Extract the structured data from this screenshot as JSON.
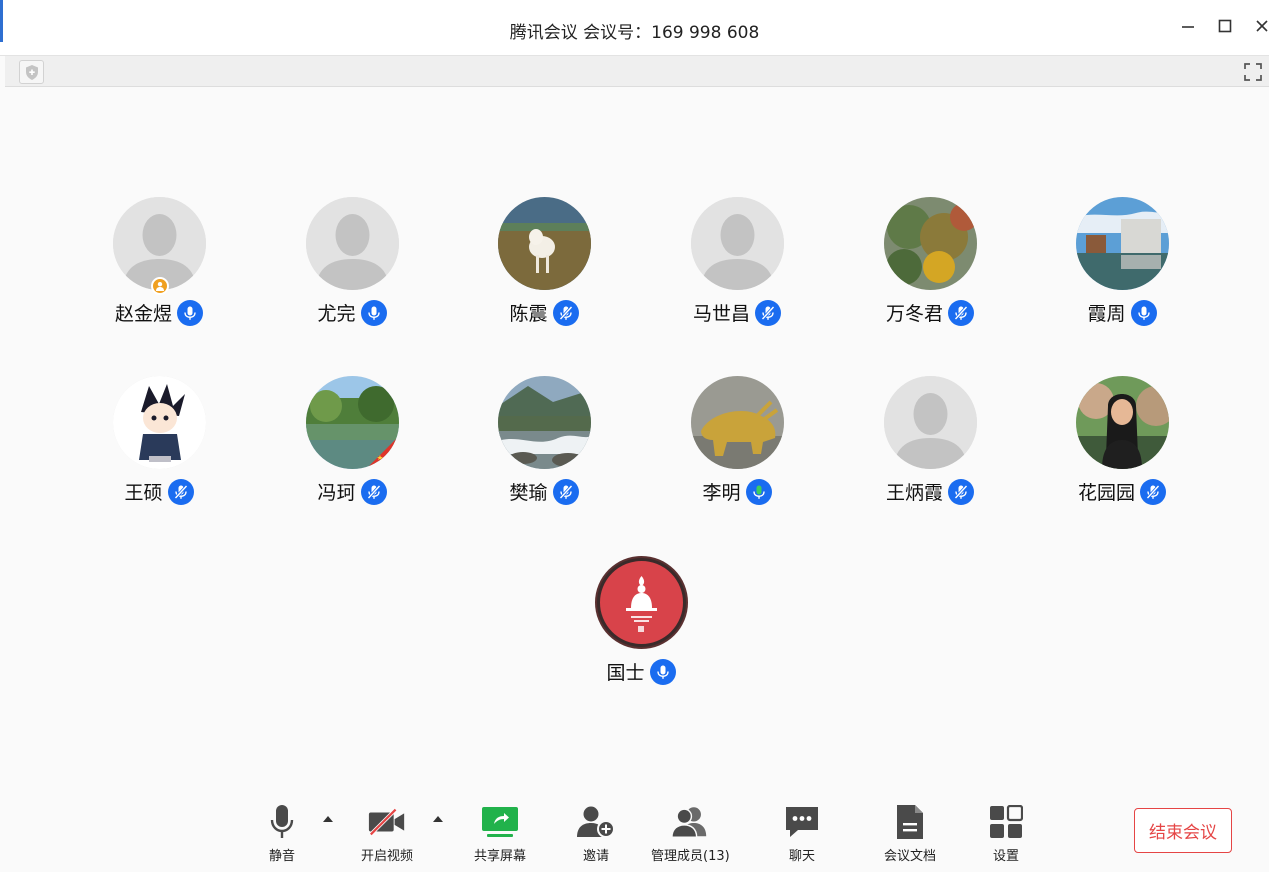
{
  "window": {
    "title": "腾讯会议 会议号：169 998 608"
  },
  "participants": [
    {
      "name": "赵金煜",
      "avatar": "default-silhouette",
      "host": true,
      "mic": "on"
    },
    {
      "name": "尤完",
      "avatar": "default-silhouette",
      "host": false,
      "mic": "on"
    },
    {
      "name": "陈震",
      "avatar": "photo-lamb",
      "host": false,
      "mic": "muted"
    },
    {
      "name": "马世昌",
      "avatar": "default-silhouette",
      "host": false,
      "mic": "muted"
    },
    {
      "name": "万冬君",
      "avatar": "photo-autumn-trees",
      "host": false,
      "mic": "muted"
    },
    {
      "name": "霞周",
      "avatar": "photo-building-lake",
      "host": false,
      "mic": "on"
    },
    {
      "name": "王硕",
      "avatar": "cartoon-ninja",
      "host": false,
      "mic": "muted"
    },
    {
      "name": "冯珂",
      "avatar": "photo-lake-trees",
      "host": false,
      "mic": "muted"
    },
    {
      "name": "樊瑜",
      "avatar": "photo-stream",
      "host": false,
      "mic": "muted"
    },
    {
      "name": "李明",
      "avatar": "photo-golden-bull",
      "host": false,
      "mic": "speaking"
    },
    {
      "name": "王炳霞",
      "avatar": "default-silhouette",
      "host": false,
      "mic": "muted"
    },
    {
      "name": "花园园",
      "avatar": "photo-woman",
      "host": false,
      "mic": "muted"
    },
    {
      "name": "国士",
      "avatar": "red-buddha-logo",
      "host": false,
      "mic": "on"
    }
  ],
  "toolbar": {
    "mute_label": "静音",
    "video_label": "开启视频",
    "share_label": "共享屏幕",
    "invite_label": "邀请",
    "members_label": "管理成员(13)",
    "chat_label": "聊天",
    "docs_label": "会议文档",
    "settings_label": "设置",
    "end_label": "结束会议"
  },
  "colors": {
    "mic_blue": "#1a6cf0",
    "speaking_green": "#3ccf5c",
    "end_red": "#e54545",
    "share_green": "#21b24b",
    "host_orange": "#f0a020"
  }
}
